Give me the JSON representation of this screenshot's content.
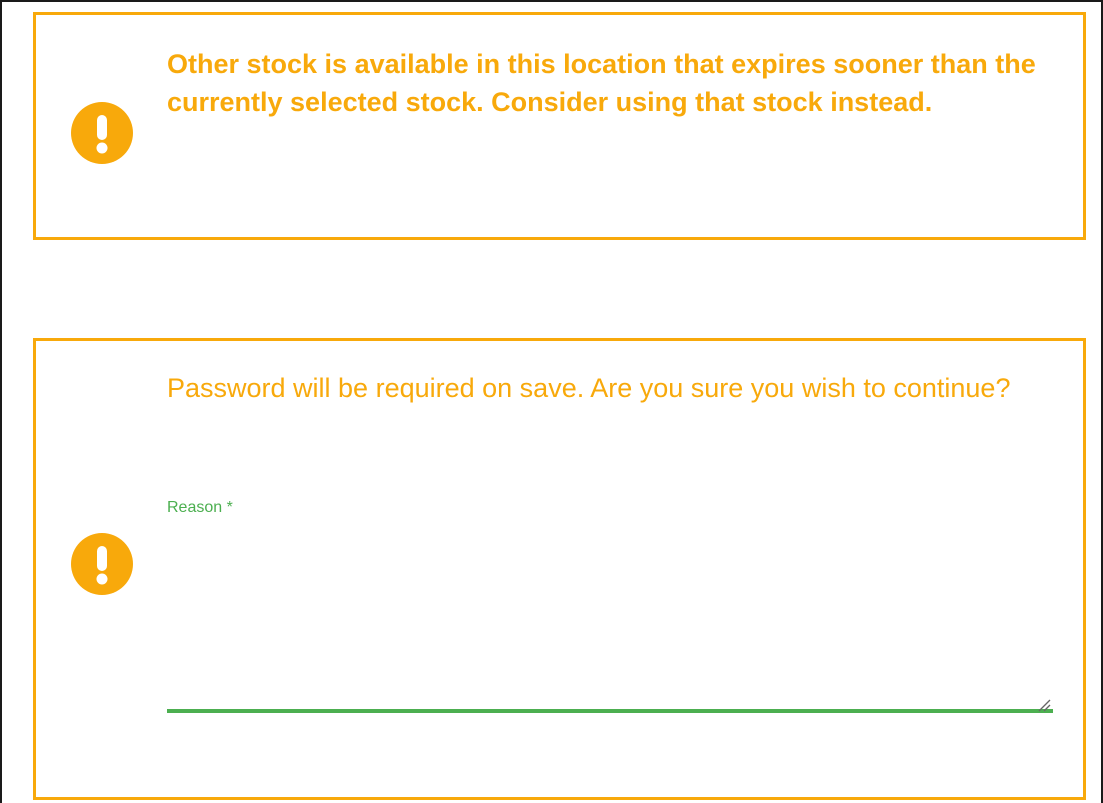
{
  "alerts": {
    "stock_warning": {
      "icon": "exclamation-circle-icon",
      "message": "Other stock is available in this location that expires sooner than the currently selected stock. Consider using that stock instead."
    },
    "password_warning": {
      "icon": "exclamation-circle-icon",
      "message": "Password will be required on save. Are you sure you wish to continue?",
      "reason_label": "Reason *",
      "reason_value": "",
      "reason_placeholder": ""
    }
  },
  "colors": {
    "warning": "#f8a90b",
    "success": "#4caf50",
    "frame": "#1a1a1a"
  }
}
